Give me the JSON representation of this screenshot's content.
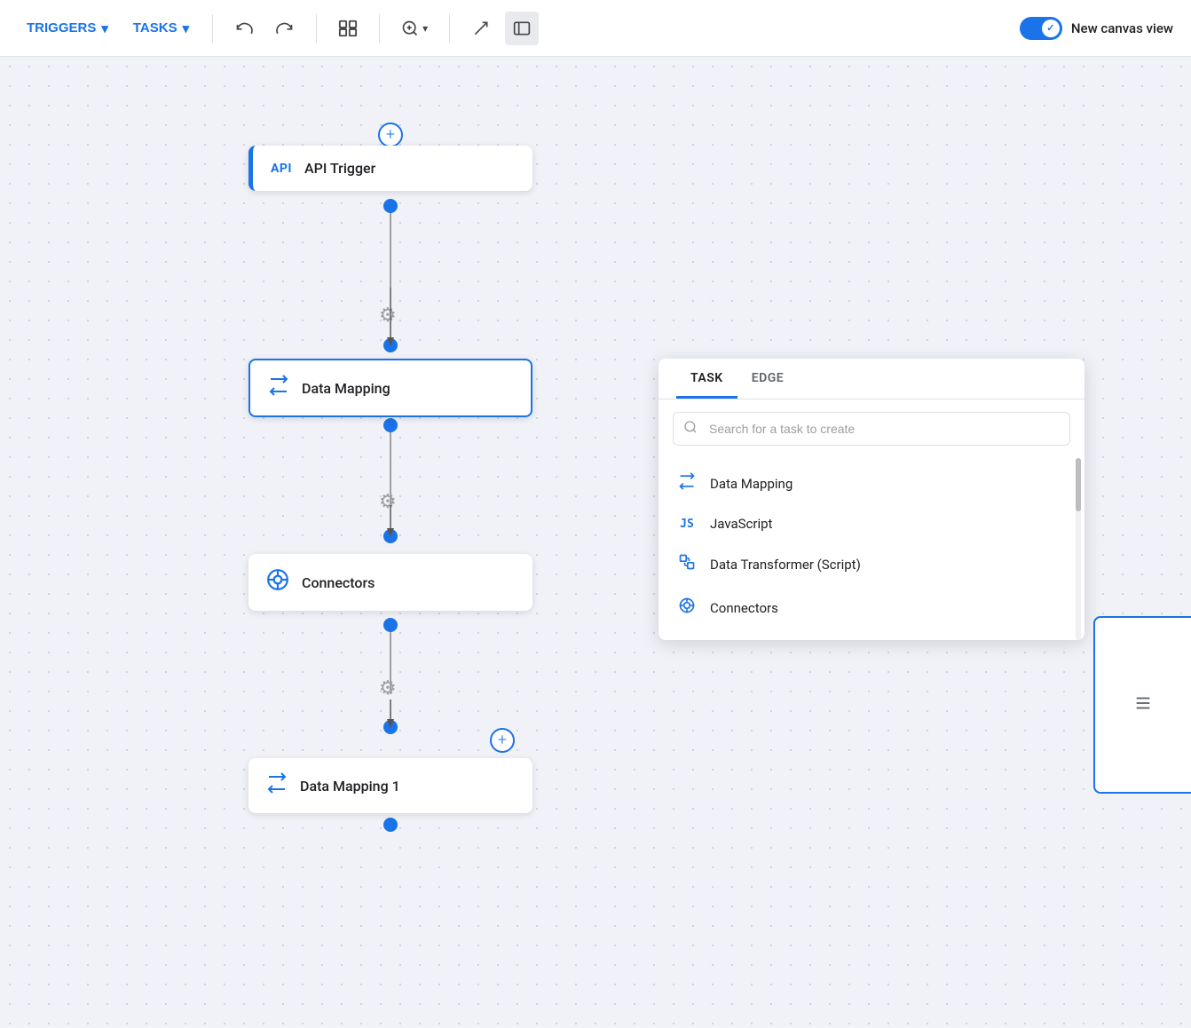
{
  "toolbar": {
    "triggers_label": "TRIGGERS",
    "tasks_label": "TASKS",
    "new_canvas_label": "New canvas view",
    "chevron": "▾"
  },
  "canvas": {
    "nodes": [
      {
        "id": "api-trigger",
        "label": "API Trigger",
        "type": "api"
      },
      {
        "id": "data-mapping",
        "label": "Data Mapping",
        "type": "datamapping"
      },
      {
        "id": "connectors",
        "label": "Connectors",
        "type": "connectors"
      },
      {
        "id": "data-mapping-1",
        "label": "Data Mapping 1",
        "type": "datamapping2"
      }
    ]
  },
  "dropdown": {
    "tabs": [
      {
        "id": "task",
        "label": "TASK"
      },
      {
        "id": "edge",
        "label": "EDGE"
      }
    ],
    "active_tab": "task",
    "search_placeholder": "Search for a task to create",
    "items": [
      {
        "id": "data-mapping",
        "label": "Data Mapping",
        "icon": "arrows"
      },
      {
        "id": "javascript",
        "label": "JavaScript",
        "icon": "js"
      },
      {
        "id": "data-transformer",
        "label": "Data Transformer (Script)",
        "icon": "transformer"
      },
      {
        "id": "connectors",
        "label": "Connectors",
        "icon": "connector"
      }
    ]
  }
}
